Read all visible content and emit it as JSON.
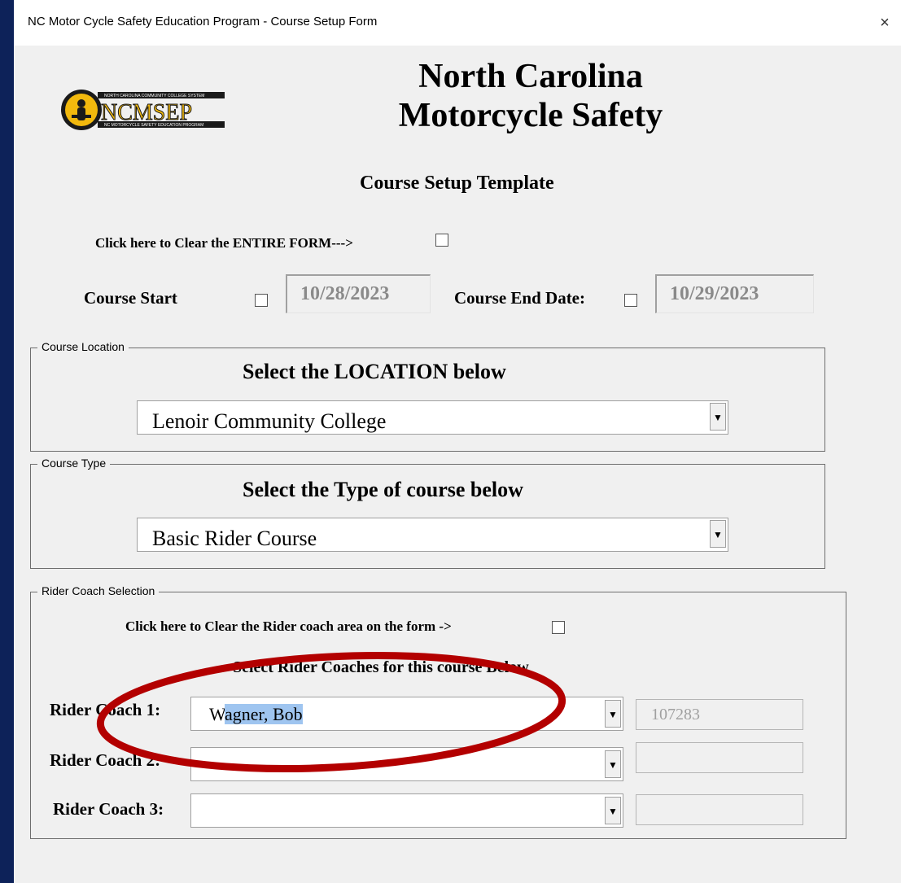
{
  "window": {
    "title": "NC Motor Cycle Safety Education Program - Course Setup Form",
    "close_label": "×"
  },
  "logo": {
    "top_text": "NORTH CAROLINA COMMUNITY COLLEGE SYSTEM",
    "name": "NCMSEP",
    "bottom_text": "NC MOTORCYCLE SAFETY EDUCATION PROGRAM"
  },
  "header": {
    "line1": "North Carolina",
    "line2": "Motorcycle Safety",
    "subtitle": "Course Setup Template"
  },
  "clear_form_label": "Click here to Clear the ENTIRE FORM--->",
  "dates": {
    "start_label": "Course Start",
    "start_value": "10/28/2023",
    "end_label": "Course End Date:",
    "end_value": "10/29/2023"
  },
  "location": {
    "legend": "Course Location",
    "heading": "Select the LOCATION below",
    "value": "Lenoir Community College"
  },
  "course_type": {
    "legend": "Course Type",
    "heading": "Select the Type of course below",
    "value": "Basic Rider Course"
  },
  "coaches": {
    "legend": "Rider Coach Selection",
    "clear_label": "Click here to Clear the Rider coach area on the form ->",
    "heading": "Select Rider Coaches for this course Below",
    "rows": [
      {
        "label": "Rider Coach 1:",
        "value_first": "W",
        "value_selected": "agner, Bob",
        "id": "107283"
      },
      {
        "label": "Rider Coach 2:",
        "value_first": "",
        "value_selected": "",
        "id": ""
      },
      {
        "label": "Rider Coach 3:",
        "value_first": "",
        "value_selected": "",
        "id": ""
      }
    ]
  },
  "colors": {
    "background": "#0d2259",
    "annotation_oval": "#b30000",
    "selection": "#9fc5f0"
  }
}
